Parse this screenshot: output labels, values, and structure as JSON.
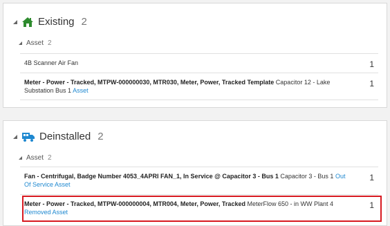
{
  "existing": {
    "title": "Existing",
    "count": "2",
    "asset_label": "Asset",
    "asset_count": "2",
    "rows": [
      {
        "text": "4B Scanner Air Fan",
        "num": "1"
      },
      {
        "bold": "Meter - Power - Tracked, MTPW-000000030, MTR030, Meter, Power, Tracked Template",
        "rest": " Capacitor 12 - Lake Substation Bus 1 ",
        "link": "Asset",
        "num": "1"
      }
    ]
  },
  "deinstalled": {
    "title": "Deinstalled",
    "count": "2",
    "asset_label": "Asset",
    "asset_count": "2",
    "rows": [
      {
        "bold": "Fan - Centrifugal, Badge Number 4053_4APRI FAN_1, In Service @ Capacitor 3 - Bus 1",
        "rest": " Capacitor 3 - Bus 1 ",
        "link": "Out Of Service Asset",
        "num": "1"
      },
      {
        "bold": "Meter - Power - Tracked, MTPW-000000004, MTR004, Meter, Power, Tracked",
        "rest": " MeterFlow 650 - in WW Plant 4 ",
        "link": "Removed Asset",
        "num": "1"
      }
    ]
  },
  "colors": {
    "icon_green": "#2e8b2e",
    "icon_blue": "#1e88d0",
    "highlight": "#d71920",
    "link": "#1e88d0"
  }
}
